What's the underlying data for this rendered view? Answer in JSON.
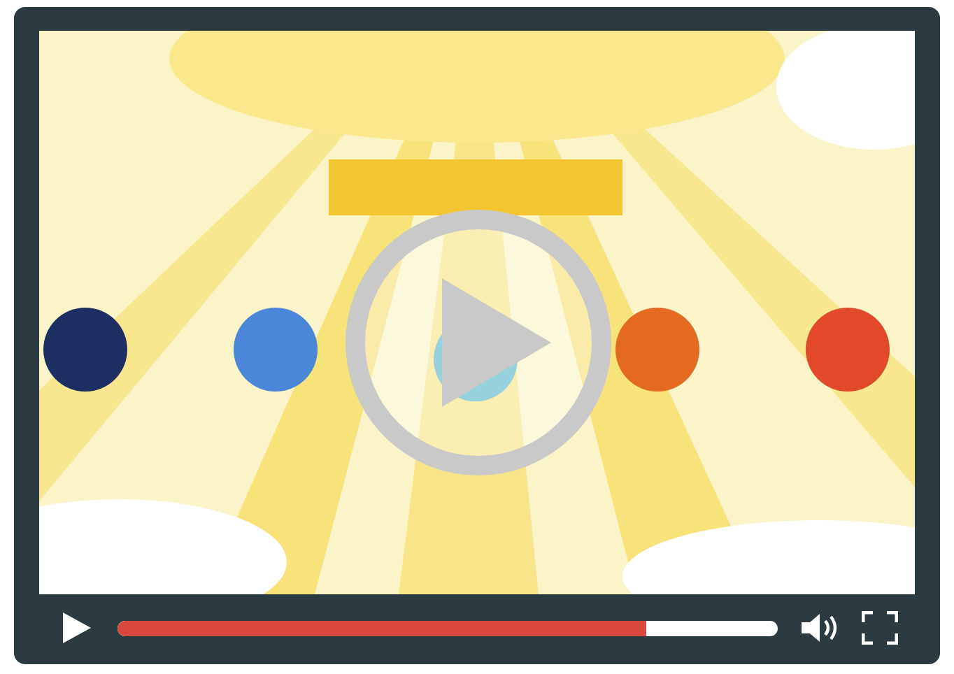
{
  "controls": {
    "paused": true,
    "progress": {
      "level": 0.8
    }
  }
}
